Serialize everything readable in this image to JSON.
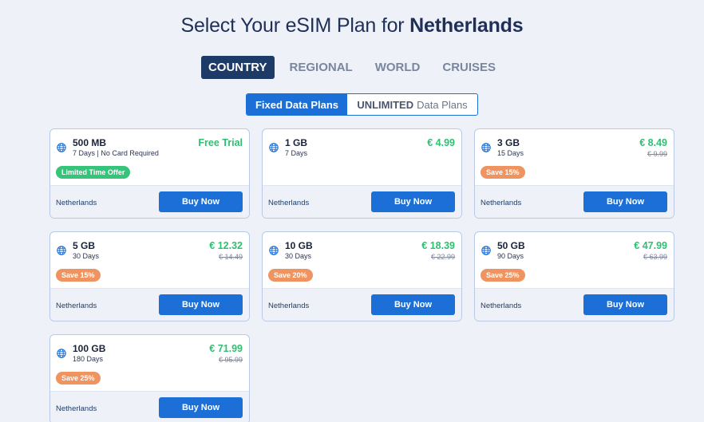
{
  "header": {
    "title_prefix": "Select Your eSIM Plan for ",
    "title_country": "Netherlands"
  },
  "region_tabs": [
    {
      "label": "COUNTRY",
      "active": true
    },
    {
      "label": "REGIONAL",
      "active": false
    },
    {
      "label": "WORLD",
      "active": false
    },
    {
      "label": "CRUISES",
      "active": false
    }
  ],
  "plan_toggle": {
    "fixed_label": "Fixed Data Plans",
    "unlimited_bold": "UNLIMITED",
    "unlimited_rest": "Data Plans"
  },
  "colors": {
    "accent": "#1b6fd6",
    "active_tab": "#1e3a66",
    "price_green": "#2fbf71",
    "badge_orange": "#ef9460",
    "badge_green": "#35c47a"
  },
  "plans": [
    {
      "data": "500 MB",
      "days": "7 Days | No Card Required",
      "price": "Free Trial",
      "old_price": "",
      "badge": "Limited Time Offer",
      "badge_color": "green",
      "country": "Netherlands",
      "button": "Buy Now",
      "icon": "globe-icon"
    },
    {
      "data": "1 GB",
      "days": "7 Days",
      "price": "€ 4.99",
      "old_price": "",
      "badge": "",
      "badge_color": "",
      "country": "Netherlands",
      "button": "Buy Now",
      "icon": "globe-icon"
    },
    {
      "data": "3 GB",
      "days": "15 Days",
      "price": "€ 8.49",
      "old_price": "€ 9.99",
      "badge": "Save 15%",
      "badge_color": "orange",
      "country": "Netherlands",
      "button": "Buy Now",
      "icon": "globe-icon"
    },
    {
      "data": "5 GB",
      "days": "30 Days",
      "price": "€ 12.32",
      "old_price": "€ 14.49",
      "badge": "Save 15%",
      "badge_color": "orange",
      "country": "Netherlands",
      "button": "Buy Now",
      "icon": "globe-icon"
    },
    {
      "data": "10 GB",
      "days": "30 Days",
      "price": "€ 18.39",
      "old_price": "€ 22.99",
      "badge": "Save 20%",
      "badge_color": "orange",
      "country": "Netherlands",
      "button": "Buy Now",
      "icon": "globe-icon"
    },
    {
      "data": "50 GB",
      "days": "90 Days",
      "price": "€ 47.99",
      "old_price": "€ 63.99",
      "badge": "Save 25%",
      "badge_color": "orange",
      "country": "Netherlands",
      "button": "Buy Now",
      "icon": "globe-icon"
    },
    {
      "data": "100 GB",
      "days": "180 Days",
      "price": "€ 71.99",
      "old_price": "€ 95.99",
      "badge": "Save 25%",
      "badge_color": "orange",
      "country": "Netherlands",
      "button": "Buy Now",
      "icon": "globe-icon"
    }
  ]
}
